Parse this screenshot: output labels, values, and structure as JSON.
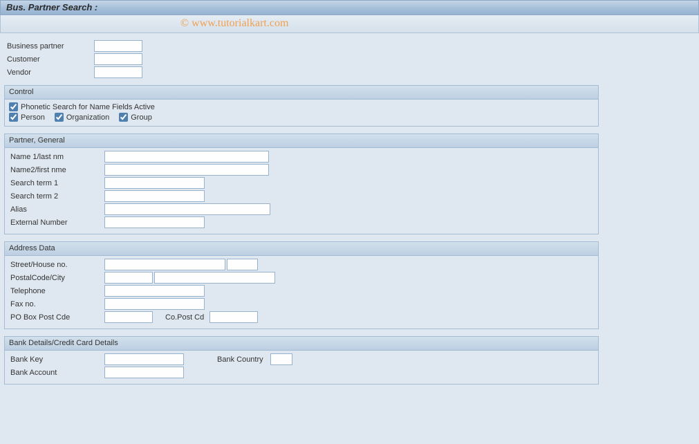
{
  "title": "Bus. Partner Search :",
  "watermark": "© www.tutorialkart.com",
  "top_fields": {
    "business_partner_label": "Business partner",
    "business_partner_value": "",
    "customer_label": "Customer",
    "customer_value": "",
    "vendor_label": "Vendor",
    "vendor_value": ""
  },
  "control": {
    "header": "Control",
    "phonetic_label": "Phonetic Search for Name Fields Active",
    "phonetic_checked": true,
    "person_label": "Person",
    "person_checked": true,
    "organization_label": "Organization",
    "organization_checked": true,
    "group_label": "Group",
    "group_checked": true
  },
  "partner_general": {
    "header": "Partner, General",
    "name1_label": "Name 1/last nm",
    "name1_value": "",
    "name2_label": "Name2/first nme",
    "name2_value": "",
    "search_term1_label": "Search term 1",
    "search_term1_value": "",
    "search_term2_label": "Search term 2",
    "search_term2_value": "",
    "alias_label": "Alias",
    "alias_value": "",
    "external_number_label": "External Number",
    "external_number_value": ""
  },
  "address": {
    "header": "Address Data",
    "street_label": "Street/House no.",
    "street_value": "",
    "house_value": "",
    "postal_label": "PostalCode/City",
    "postal_value": "",
    "city_value": "",
    "telephone_label": "Telephone",
    "telephone_value": "",
    "fax_label": "Fax no.",
    "fax_value": "",
    "pobox_label": "PO Box Post Cde",
    "pobox_value": "",
    "copost_label": "Co.Post Cd",
    "copost_value": ""
  },
  "bank": {
    "header": "Bank Details/Credit Card Details",
    "bank_key_label": "Bank Key",
    "bank_key_value": "",
    "bank_country_label": "Bank Country",
    "bank_country_value": "",
    "bank_account_label": "Bank Account",
    "bank_account_value": ""
  }
}
